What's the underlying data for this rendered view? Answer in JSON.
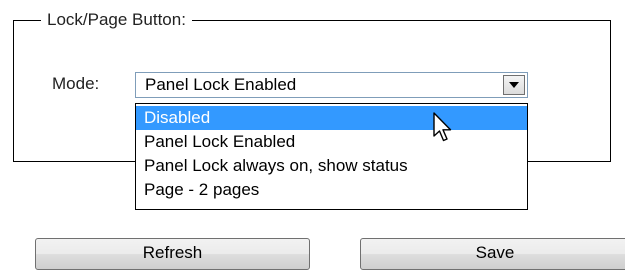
{
  "group": {
    "title": "Lock/Page Button:"
  },
  "mode": {
    "label": "Mode:",
    "selected_value": "Panel Lock Enabled",
    "options": [
      "Disabled",
      "Panel Lock Enabled",
      "Panel Lock always on, show status",
      "Page - 2 pages"
    ],
    "highlighted_option": "Disabled"
  },
  "buttons": {
    "refresh_label": "Refresh",
    "save_label": "Save"
  },
  "colors": {
    "highlight": "#3399ff",
    "border": "#000000"
  },
  "icons": {
    "dropdown_arrow": "chevron-down-icon",
    "cursor": "mouse-pointer-icon"
  }
}
